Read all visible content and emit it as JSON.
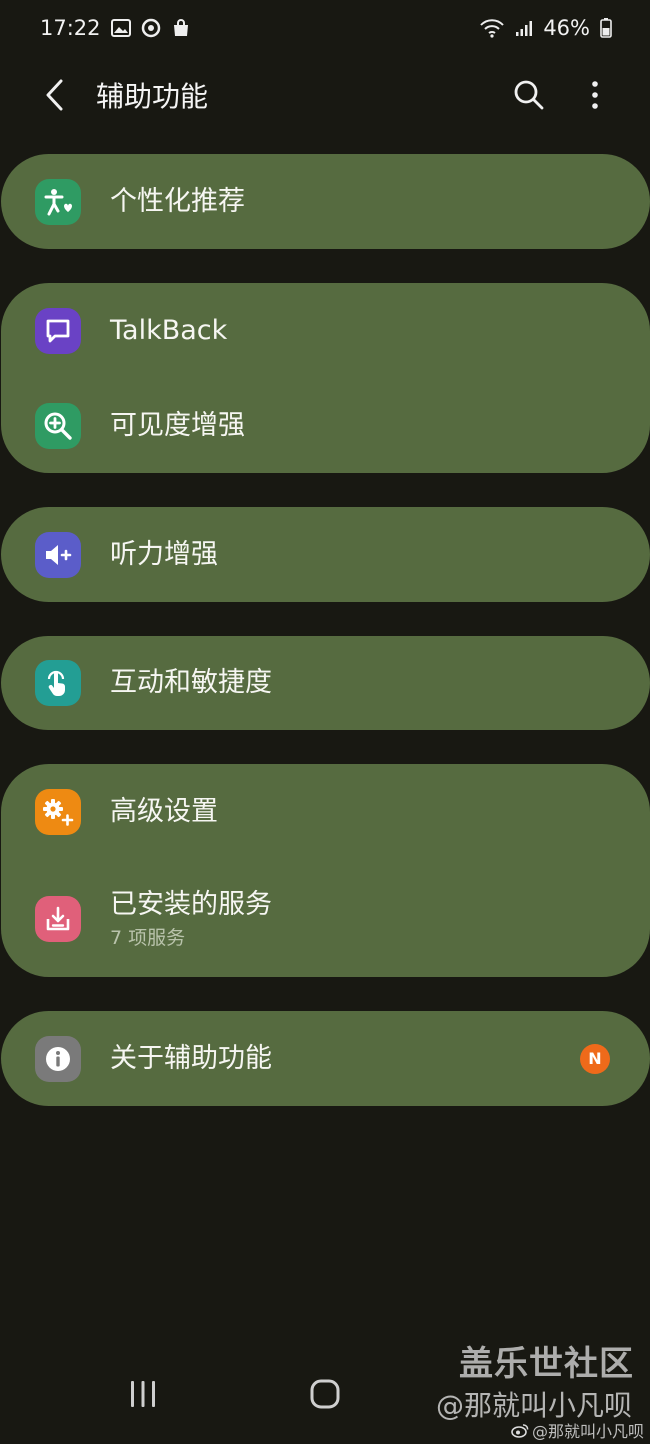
{
  "status_bar": {
    "time": "17:22",
    "battery": "46%"
  },
  "app_bar": {
    "title": "辅助功能"
  },
  "sections": [
    {
      "items": [
        {
          "label": "个性化推荐",
          "icon": "accessibility-person-icon",
          "icon_color": "#2f9b63"
        }
      ]
    },
    {
      "items": [
        {
          "label": "TalkBack",
          "icon": "talkback-icon",
          "icon_color": "#6a42c5"
        },
        {
          "label": "可见度增强",
          "icon": "zoom-in-icon",
          "icon_color": "#2f9b63"
        }
      ]
    },
    {
      "items": [
        {
          "label": "听力增强",
          "icon": "hearing-volume-icon",
          "icon_color": "#5b5dc9"
        }
      ]
    },
    {
      "items": [
        {
          "label": "互动和敏捷度",
          "icon": "touch-hand-icon",
          "icon_color": "#239e94"
        }
      ]
    },
    {
      "items": [
        {
          "label": "高级设置",
          "icon": "advanced-settings-icon",
          "icon_color": "#ee8a12"
        },
        {
          "label": "已安装的服务",
          "sub": "7 项服务",
          "icon": "installed-download-icon",
          "icon_color": "#e0607a"
        }
      ]
    },
    {
      "items": [
        {
          "label": "关于辅助功能",
          "icon": "info-icon",
          "icon_color": "#7a7a7a",
          "badge": "N"
        }
      ]
    }
  ],
  "watermark": {
    "line1": "盖乐世社区",
    "line2": "@那就叫小凡呗",
    "line3": "@那就叫小凡呗"
  },
  "colors": {
    "background": "#181812",
    "card": "#566b40",
    "badge": "#ef6a1a"
  }
}
